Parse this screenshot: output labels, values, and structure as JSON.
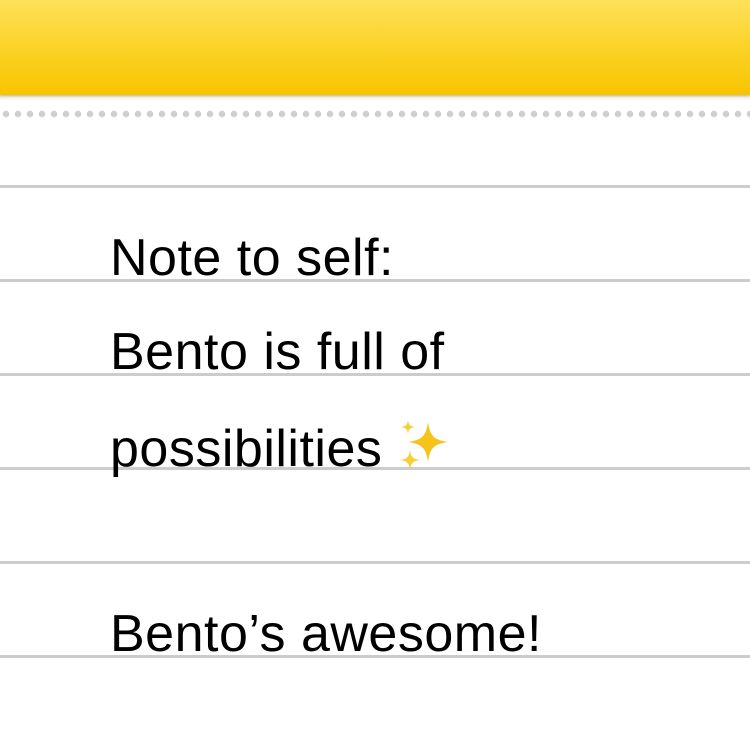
{
  "note": {
    "lines": [
      "Note to self:",
      "Bento is full of",
      "possibilities",
      "",
      "Bento’s awesome!"
    ],
    "line3_emoji": "sparkles-icon"
  },
  "colors": {
    "header_yellow": "#fcd42c",
    "rule_gray": "#cccccc",
    "text": "#000000",
    "sparkle": "#f5c31a"
  }
}
